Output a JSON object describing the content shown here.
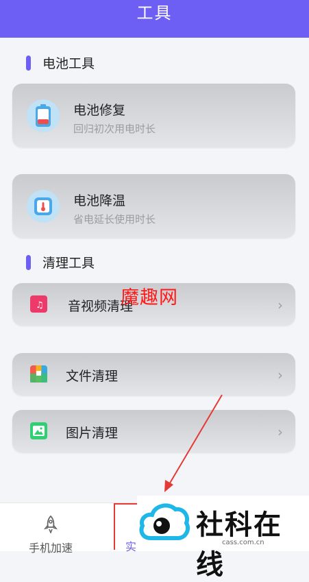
{
  "header": {
    "title": "工具"
  },
  "sections": {
    "battery": {
      "title": "电池工具"
    },
    "clean": {
      "title": "清理工具"
    }
  },
  "battery_tools": [
    {
      "name": "电池修复",
      "desc": "回归初次用电时长",
      "icon": "battery-icon"
    },
    {
      "name": "电池降温",
      "desc": "省电延长使用时长",
      "icon": "thermometer-icon"
    }
  ],
  "clean_tools": [
    {
      "name": "音视频清理",
      "icon": "music-file-icon",
      "color": "#ee3a6a"
    },
    {
      "name": "文件清理",
      "icon": "archive-icon",
      "color": "#f2b01e"
    },
    {
      "name": "图片清理",
      "icon": "image-icon",
      "color": "#2fcf73"
    }
  ],
  "watermark": "魔趣网",
  "tabbar": {
    "tab1": "手机加速",
    "tab2_partial": "实"
  },
  "logo": {
    "name": "社科在线",
    "url": "cass.com.cn"
  },
  "colors": {
    "accent": "#6d5ef4",
    "annotation_red": "#e53935"
  }
}
